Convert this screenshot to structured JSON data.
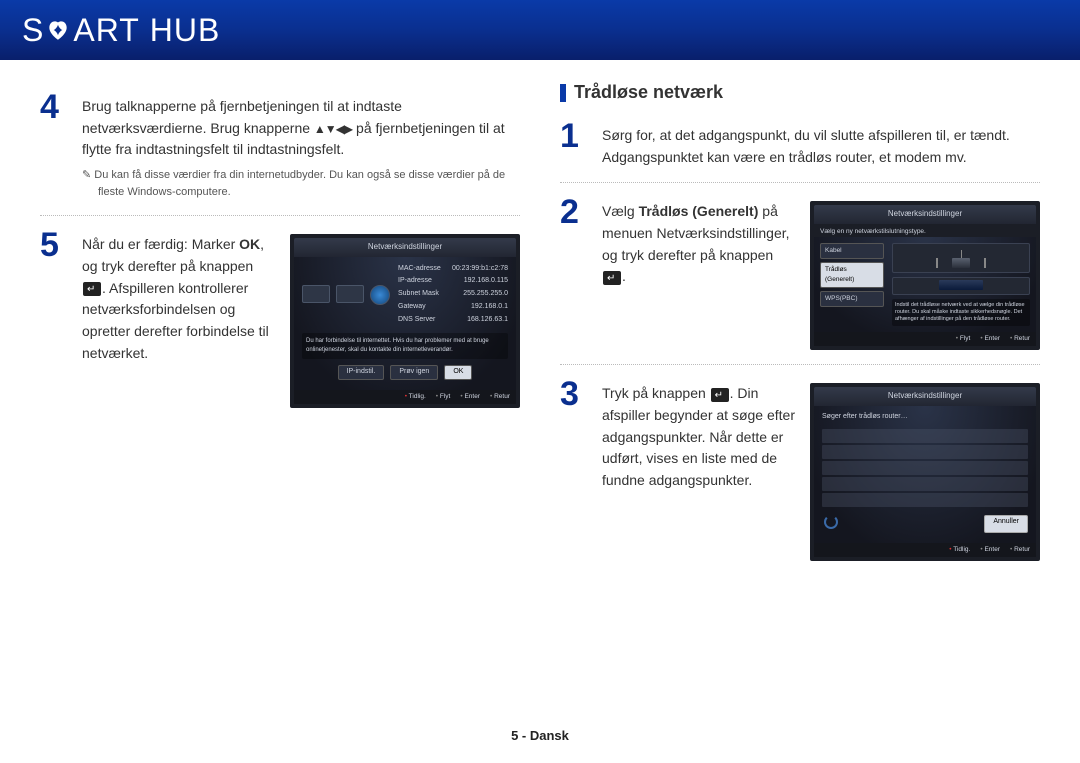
{
  "header": {
    "logo_pre": "S",
    "logo_post": "ART",
    "logo_sub": "HUB"
  },
  "left": {
    "step4": {
      "line1": "Brug talknapperne på fjernbetjeningen til at indtaste netværksværdierne.",
      "line2a": "Brug knapperne ",
      "line2b": " på fjernbetjeningen til at flytte fra indtastningsfelt til indtastningsfelt.",
      "note": "Du kan få disse værdier fra din internetudbyder. Du kan også se disse værdier på de fleste Windows-computere."
    },
    "step5": {
      "text_a": "Når du er færdig: Marker ",
      "text_bold": "OK",
      "text_b": ", og tryk derefter på knappen ",
      "text_c": ". Afspilleren kontrollerer netværksforbindelsen og opretter derefter forbindelse til netværket."
    },
    "tv1": {
      "title": "Netværksindstillinger",
      "rows": [
        [
          "MAC-adresse",
          "00:23:99:b1:c2:78"
        ],
        [
          "IP-adresse",
          "192.168.0.115"
        ],
        [
          "Subnet Mask",
          "255.255.255.0"
        ],
        [
          "Gateway",
          "192.168.0.1"
        ],
        [
          "DNS Server",
          "168.126.63.1"
        ]
      ],
      "msg": "Du har forbindelse til internettet. Hvis du har problemer med at bruge onlinetjenester, skal du kontakte din internetleverandør.",
      "btn1": "IP-indstil.",
      "btn2": "Prøv igen",
      "btn3": "OK",
      "nav1": "Tidlig.",
      "nav2": "Flyt",
      "nav3": "Enter",
      "nav4": "Retur"
    }
  },
  "right": {
    "title": "Trådløse netværk",
    "step1": "Sørg for, at det adgangspunkt, du vil slutte afspilleren til, er tændt. Adgangspunktet kan være en trådløs router, et modem mv.",
    "step2": {
      "a": "Vælg ",
      "b": "Trådløs (Generelt)",
      "c": " på menuen Netværksindstillinger, og tryk derefter på knappen ",
      "d": "."
    },
    "tv2": {
      "title": "Netværksindstillinger",
      "sub": "Vælg en ny netværkstilslutningstype.",
      "opt1": "Kabel",
      "opt2": "Trådløs\n(Generelt)",
      "opt3": "WPS(PBC)",
      "desc": "Indstil det trådløse netværk ved at vælge din trådløse router. Du skal måske indtaste sikkerhedsnøgle. Det afhænger af indstillinger på den trådløse router.",
      "nav1": "Flyt",
      "nav2": "Enter",
      "nav3": "Retur"
    },
    "step3": {
      "a": "Tryk på knappen ",
      "b": ". Din afspiller begynder at søge efter adgangspunkter. Når dette er udført, vises en liste med de fundne adgangspunkter."
    },
    "tv3": {
      "title": "Netværksindstillinger",
      "msg": "Søger efter trådløs router…",
      "btn": "Annuller",
      "nav1": "Tidlig.",
      "nav2": "Enter",
      "nav3": "Retur"
    }
  },
  "footer": "5 - Dansk"
}
